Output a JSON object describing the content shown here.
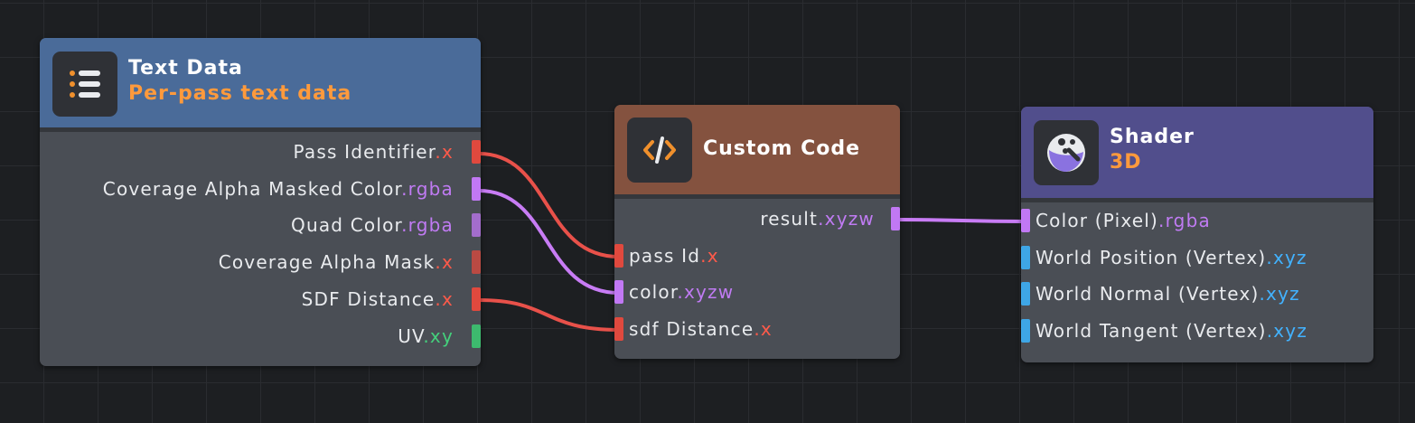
{
  "colors": {
    "text_data_header": "#4a6b99",
    "custom_code_header": "#84523f",
    "shader_header": "#514e8c",
    "node_body": "#4a4e55",
    "wire_red": "#e8514a",
    "wire_purple": "#c87cf5",
    "accent_orange": "#ff9a3c"
  },
  "text_data": {
    "icon": "list-icon",
    "title": "Text Data",
    "subtitle": "Per-pass text data",
    "outputs": [
      {
        "name": "Pass Identifier",
        "swizzle": ".x",
        "type": "red"
      },
      {
        "name": "Coverage Alpha Masked Color",
        "swizzle": ".rgba",
        "type": "purple"
      },
      {
        "name": "Quad Color",
        "swizzle": ".rgba",
        "type": "purple"
      },
      {
        "name": "Coverage Alpha Mask",
        "swizzle": ".x",
        "type": "red"
      },
      {
        "name": "SDF Distance",
        "swizzle": ".x",
        "type": "red"
      },
      {
        "name": "UV",
        "swizzle": ".xy",
        "type": "green"
      }
    ]
  },
  "custom_code": {
    "icon": "code-icon",
    "title": "Custom Code",
    "outputs": [
      {
        "name": "result",
        "swizzle": ".xyzw",
        "type": "purple"
      }
    ],
    "inputs": [
      {
        "name": "pass Id",
        "swizzle": ".x",
        "type": "red"
      },
      {
        "name": "color",
        "swizzle": ".xyzw",
        "type": "purple"
      },
      {
        "name": "sdf Distance",
        "swizzle": ".x",
        "type": "red"
      }
    ]
  },
  "shader": {
    "icon": "shader-sphere-icon",
    "title": "Shader",
    "subtitle": "3D",
    "inputs": [
      {
        "name": "Color (Pixel)",
        "swizzle": ".rgba",
        "type": "purple"
      },
      {
        "name": "World Position (Vertex)",
        "swizzle": ".xyz",
        "type": "blue"
      },
      {
        "name": "World Normal (Vertex)",
        "swizzle": ".xyz",
        "type": "blue"
      },
      {
        "name": "World Tangent (Vertex)",
        "swizzle": ".xyz",
        "type": "blue"
      }
    ]
  }
}
